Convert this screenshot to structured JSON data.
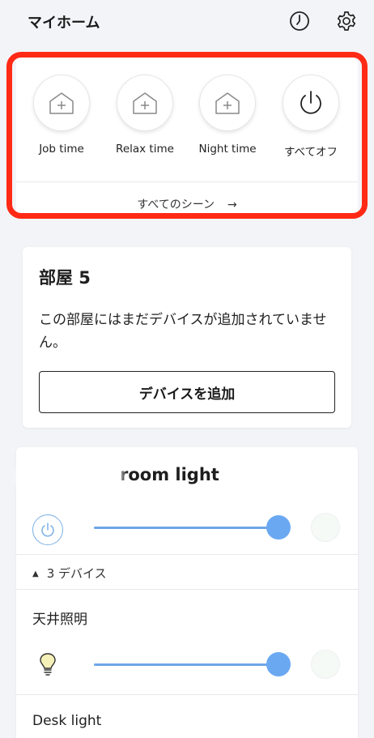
{
  "header": {
    "title": "マイホーム",
    "icons": [
      "clock-icon",
      "gear-icon"
    ]
  },
  "scenes": {
    "items": [
      {
        "label": "Job time",
        "icon": "house-plus-icon"
      },
      {
        "label": "Relax time",
        "icon": "house-plus-icon"
      },
      {
        "label": "Night time",
        "icon": "house-plus-icon"
      },
      {
        "label": "すべてオフ",
        "icon": "power-icon"
      }
    ],
    "all_scenes_label": "すべてのシーン",
    "all_scenes_arrow": "→",
    "highlight_color": "#ff2a16"
  },
  "room": {
    "title": "部屋 5",
    "message": "この部屋にはまだデバイスが追加されていません。",
    "add_device_label": "デバイスを追加"
  },
  "group": {
    "name": "room light",
    "brightness": 1.0,
    "device_count_label": "3 デバイス",
    "devices": [
      {
        "name": "天井照明",
        "brightness": 1.0,
        "icon": "bulb-icon"
      },
      {
        "name": "Desk light"
      }
    ],
    "accent_color": "#6aa8f2"
  }
}
